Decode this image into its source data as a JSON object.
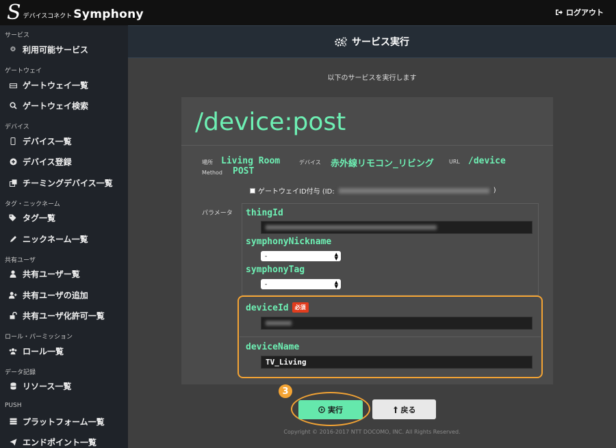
{
  "app": {
    "logo_mark": "S",
    "logo_sub": "デバイスコネクト",
    "logo_name": "Symphony",
    "logout_label": "ログアウト"
  },
  "sidebar": {
    "sections": [
      {
        "label": "サービス",
        "items": [
          {
            "label": "利用可能サービス",
            "icon": "gears-icon"
          }
        ]
      },
      {
        "label": "ゲートウェイ",
        "items": [
          {
            "label": "ゲートウェイ一覧",
            "icon": "hdd-icon"
          },
          {
            "label": "ゲートウェイ検索",
            "icon": "search-icon"
          }
        ]
      },
      {
        "label": "デバイス",
        "items": [
          {
            "label": "デバイス一覧",
            "icon": "mobile-icon"
          },
          {
            "label": "デバイス登録",
            "icon": "plus-circle-icon"
          },
          {
            "label": "チーミングデバイス一覧",
            "icon": "clone-icon"
          }
        ]
      },
      {
        "label": "タグ・ニックネーム",
        "items": [
          {
            "label": "タグ一覧",
            "icon": "tags-icon"
          },
          {
            "label": "ニックネーム一覧",
            "icon": "pencil-icon"
          }
        ]
      },
      {
        "label": "共有ユーザ",
        "items": [
          {
            "label": "共有ユーザー覧",
            "icon": "user-icon"
          },
          {
            "label": "共有ユーザの追加",
            "icon": "user-plus-icon"
          },
          {
            "label": "共有ユーザ化許可一覧",
            "icon": "unlock-icon"
          }
        ]
      },
      {
        "label": "ロール・パーミッション",
        "items": [
          {
            "label": "ロール一覧",
            "icon": "users-icon"
          }
        ]
      },
      {
        "label": "データ記録",
        "items": [
          {
            "label": "リソース一覧",
            "icon": "database-icon"
          }
        ]
      },
      {
        "label": "PUSH",
        "items": [
          {
            "label": "プラットフォーム一覧",
            "icon": "server-icon"
          },
          {
            "label": "エンドポイント一覧",
            "icon": "send-icon"
          }
        ]
      }
    ]
  },
  "header": {
    "title": "サービス実行",
    "icon": "gears-icon"
  },
  "main": {
    "intro": "以下のサービスを実行します",
    "service_path": "/device:post",
    "meta": {
      "place_label": "場所",
      "place_value": "Living Room",
      "device_label": "デバイス",
      "device_value": "赤外線リモコン_リビング",
      "url_label": "URL",
      "url_value": "/device",
      "method_label": "Method",
      "method_value": "POST"
    },
    "gateway_check": {
      "label_prefix": "ゲートウェイID付与 (ID:",
      "label_suffix": ")",
      "checked": false
    },
    "param_label": "パラメータ",
    "params": [
      {
        "name": "thingId"
      },
      {
        "name": "symphonyNickname",
        "select_value": "-"
      },
      {
        "name": "symphonyTag",
        "select_value": "-"
      },
      {
        "name": "deviceId",
        "required_label": "必須"
      },
      {
        "name": "deviceName",
        "value": "TV_Living"
      }
    ],
    "step_number": "3",
    "run_label": "実行",
    "back_label": "戻る",
    "copyright": "Copyright © 2016-2017 NTT DOCOMO, INC. All Rights Reserved."
  },
  "colors": {
    "accent": "#6ef0b4",
    "highlight": "#f4a434",
    "required": "#e23d1e"
  }
}
